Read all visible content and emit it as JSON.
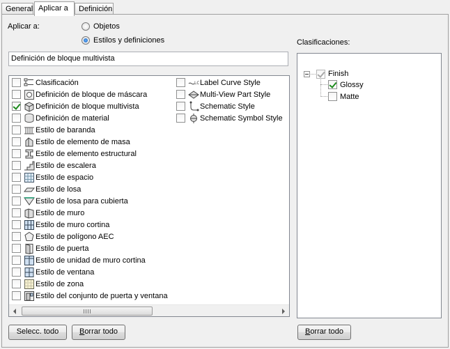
{
  "tabs": [
    {
      "label": "General",
      "active": false
    },
    {
      "label": "Aplicar a",
      "active": true
    },
    {
      "label": "Definición",
      "active": false
    }
  ],
  "apply_to": {
    "label": "Aplicar a:",
    "options": [
      {
        "label": "Objetos",
        "selected": false
      },
      {
        "label": "Estilos y definiciones",
        "selected": true
      }
    ]
  },
  "current_value": "Definición de bloque multivista",
  "style_list": {
    "column1": [
      {
        "label": "Clasificación",
        "checked": false,
        "icon": "classification-icon"
      },
      {
        "label": "Definición de bloque de máscara",
        "checked": false,
        "icon": "mask-block-icon"
      },
      {
        "label": "Definición de bloque multivista",
        "checked": true,
        "icon": "multiview-block-icon"
      },
      {
        "label": "Definición de material",
        "checked": false,
        "icon": "material-icon"
      },
      {
        "label": "Estilo de baranda",
        "checked": false,
        "icon": "railing-icon"
      },
      {
        "label": "Estilo de elemento de masa",
        "checked": false,
        "icon": "mass-element-icon"
      },
      {
        "label": "Estilo de elemento estructural",
        "checked": false,
        "icon": "structural-member-icon"
      },
      {
        "label": "Estilo de escalera",
        "checked": false,
        "icon": "stair-icon"
      },
      {
        "label": "Estilo de espacio",
        "checked": false,
        "icon": "space-icon"
      },
      {
        "label": "Estilo de losa",
        "checked": false,
        "icon": "slab-icon"
      },
      {
        "label": "Estilo de losa para cubierta",
        "checked": false,
        "icon": "roof-slab-icon"
      },
      {
        "label": "Estilo de muro",
        "checked": false,
        "icon": "wall-icon"
      },
      {
        "label": "Estilo de muro cortina",
        "checked": false,
        "icon": "curtain-wall-icon"
      },
      {
        "label": "Estilo de polígono AEC",
        "checked": false,
        "icon": "polygon-icon"
      },
      {
        "label": "Estilo de puerta",
        "checked": false,
        "icon": "door-icon"
      },
      {
        "label": "Estilo de unidad de muro cortina",
        "checked": false,
        "icon": "curtain-wall-unit-icon"
      },
      {
        "label": "Estilo de ventana",
        "checked": false,
        "icon": "window-icon"
      },
      {
        "label": "Estilo de zona",
        "checked": false,
        "icon": "zone-icon"
      },
      {
        "label": "Estilo del conjunto de puerta y ventana",
        "checked": false,
        "icon": "door-window-assembly-icon"
      }
    ],
    "column2": [
      {
        "label": "Label Curve Style",
        "checked": false,
        "icon": "label-curve-icon"
      },
      {
        "label": "Multi-View Part Style",
        "checked": false,
        "icon": "multiview-part-icon"
      },
      {
        "label": "Schematic Style",
        "checked": false,
        "icon": "schematic-icon"
      },
      {
        "label": "Schematic Symbol Style",
        "checked": false,
        "icon": "schematic-symbol-icon"
      }
    ],
    "scroll_grip": "III"
  },
  "classifications": {
    "label": "Clasificaciones:",
    "root": {
      "label": "Finish",
      "checked": true
    },
    "children": [
      {
        "label": "Glossy",
        "checked": true
      },
      {
        "label": "Matte",
        "checked": false
      }
    ]
  },
  "buttons": {
    "select_all": {
      "prefix": "Selecc.",
      "suffix": " todo"
    },
    "clear_all": {
      "u": "B",
      "rest": "orrar todo"
    },
    "clear_all_right": {
      "u": "B",
      "rest": "orrar todo"
    }
  }
}
